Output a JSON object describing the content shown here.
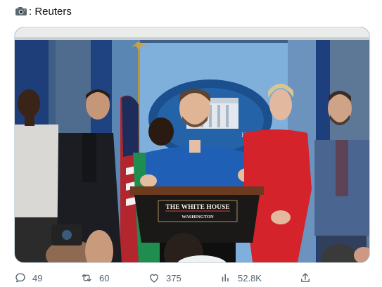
{
  "caption": {
    "icon": "camera-icon",
    "text": ": Reuters"
  },
  "photo": {
    "podium_line1": "THE WHITE HOUSE",
    "podium_line2": "WASHINGTON",
    "seal_text": "HOUSE"
  },
  "actions": {
    "replies": "49",
    "retweets": "60",
    "likes": "375",
    "views": "52.8K"
  },
  "colors": {
    "icon_gray": "#536471",
    "border": "#cfd9de"
  }
}
